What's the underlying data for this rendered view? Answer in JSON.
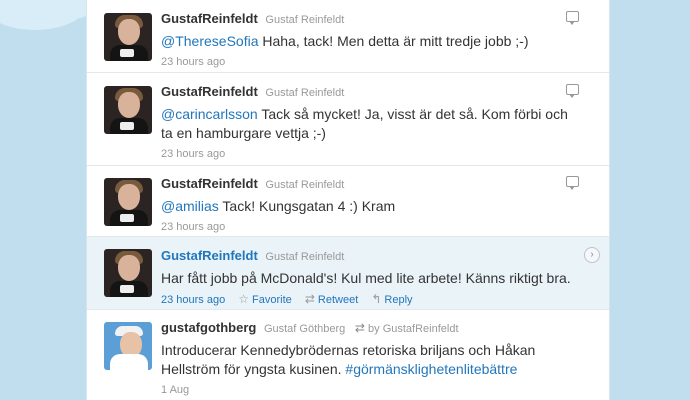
{
  "tweets": [
    {
      "screen_name": "GustafReinfeldt",
      "full_name": "Gustaf Reinfeldt",
      "mention": "@ThereseSofia",
      "text": " Haha, tack! Men detta är mitt tredje jobb ;-)",
      "time": "23 hours ago"
    },
    {
      "screen_name": "GustafReinfeldt",
      "full_name": "Gustaf Reinfeldt",
      "mention": "@carincarlsson",
      "text": " Tack så mycket! Ja, visst är det så. Kom förbi och ta en hamburgare vettja ;-)",
      "time": "23 hours ago"
    },
    {
      "screen_name": "GustafReinfeldt",
      "full_name": "Gustaf Reinfeldt",
      "mention": "@amilias",
      "text": " Tack! Kungsgatan 4 :) Kram",
      "time": "23 hours ago"
    },
    {
      "screen_name": "GustafReinfeldt",
      "full_name": "Gustaf Reinfeldt",
      "text": "Har fått jobb på McDonald's! Kul med lite arbete! Känns riktigt bra.",
      "time": "23 hours ago",
      "actions": {
        "favorite": "Favorite",
        "retweet": "Retweet",
        "reply": "Reply"
      }
    },
    {
      "screen_name": "gustafgothberg",
      "full_name": "Gustaf Göthberg",
      "retweeted_by": "by GustafReinfeldt",
      "text": "Introducerar Kennedybrödernas retoriska briljans och Håkan Hellström för yngsta kusinen. ",
      "hashtag": "#görmänsklighetenlitebättre",
      "time": "1 Aug"
    }
  ],
  "icons": {
    "reply": "speech-bubble",
    "open": "chevron-right",
    "favorite": "☆",
    "retweet": "⇄",
    "reply_action": "↰"
  },
  "colors": {
    "background": "#c0deed",
    "link": "#2276bb",
    "highlight": "#eaf3f8"
  }
}
